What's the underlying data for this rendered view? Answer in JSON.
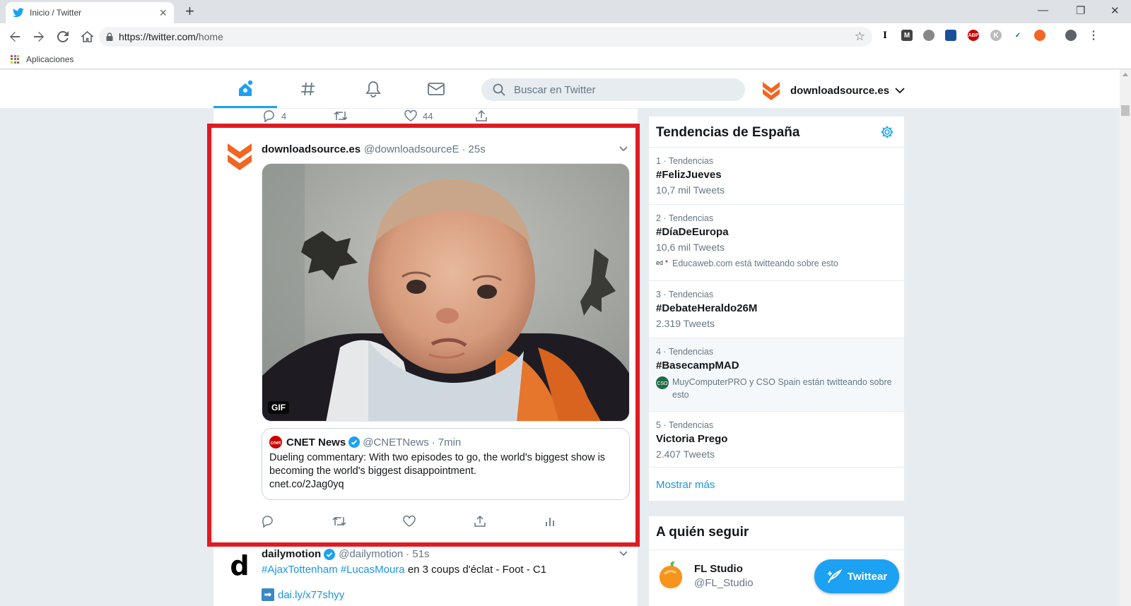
{
  "browser": {
    "tab_title": "Inicio / Twitter",
    "url_host": "https://twitter.com/",
    "url_path": "home",
    "bookmark_label": "Aplicaciones",
    "extensions": [
      "I",
      "M",
      "ABP",
      "K"
    ]
  },
  "header": {
    "search_placeholder": "Buscar en Twitter",
    "account_name": "downloadsource.es"
  },
  "prev_tweet_actions": {
    "replies": "4",
    "likes": "44"
  },
  "tweet": {
    "name": "downloadsource.es",
    "handle": "@downloadsourceE",
    "dot": "·",
    "time": "25s",
    "gif_label": "GIF",
    "quote": {
      "name": "CNET News",
      "handle": "@CNETNews",
      "dot": "·",
      "time": "7min",
      "text": "Dueling commentary: With two episodes to go, the world's biggest show is becoming the world's biggest disappointment.",
      "link": "cnet.co/2Jag0yq"
    }
  },
  "tweet2": {
    "name": "dailymotion",
    "handle": "@dailymotion",
    "dot": "·",
    "time": "51s",
    "avatar_letter": "d",
    "hashtag1": "#AjaxTottenham",
    "hashtag2": "#LucasMoura",
    "text": "en 3 coups d'éclat - Foot - C1",
    "link": "dai.ly/x77shyy"
  },
  "trends": {
    "title": "Tendencias de España",
    "items": [
      {
        "meta": "1 · Tendencias",
        "name": "#FelizJueves",
        "count": "10,7 mil Tweets"
      },
      {
        "meta": "2 · Tendencias",
        "name": "#DíaDeEuropa",
        "count": "10,6 mil Tweets",
        "context": "Educaweb.com está twitteando sobre esto"
      },
      {
        "meta": "3 · Tendencias",
        "name": "#DebateHeraldo26M",
        "count": "2.319 Tweets"
      },
      {
        "meta": "4 · Tendencias",
        "name": "#BasecampMAD",
        "context": "MuyComputerPRO y CSO Spain están twitteando sobre esto"
      },
      {
        "meta": "5 · Tendencias",
        "name": "Victoria Prego",
        "count": "2.407 Tweets"
      }
    ],
    "more": "Mostrar más"
  },
  "who_to_follow": {
    "title": "A quién seguir",
    "items": [
      {
        "name": "FL Studio",
        "handle": "@FL_Studio"
      }
    ]
  },
  "tweet_button": "Twittear",
  "colors": {
    "twitter_blue": "#1da1f2",
    "link_blue": "#1b95e0",
    "highlight_red": "#e01b22",
    "brand_orange": "#f26522"
  }
}
